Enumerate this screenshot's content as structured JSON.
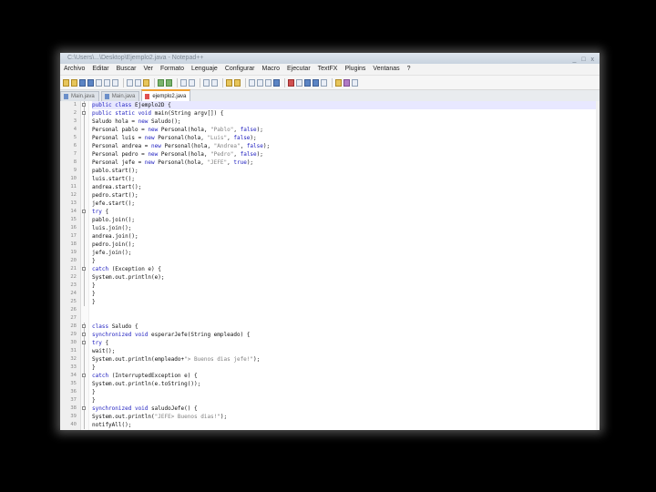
{
  "window": {
    "title": "C:\\Users\\...\\Desktop\\Ejemplo2.java - Notepad++",
    "controls": "_ □ x"
  },
  "menu": [
    "Archivo",
    "Editar",
    "Buscar",
    "Ver",
    "Formato",
    "Lenguaje",
    "Configurar",
    "Macro",
    "Ejecutar",
    "TextFX",
    "Plugins",
    "Ventanas",
    "?"
  ],
  "tabs": [
    {
      "label": "Main.java",
      "active": false
    },
    {
      "label": "Main.java",
      "active": false
    },
    {
      "label": "ejemplo2.java",
      "active": true
    }
  ],
  "lines": [
    {
      "n": "1",
      "fold": "box",
      "p": [
        [
          "kw",
          "public class "
        ],
        [
          "",
          "Ejemplo2D {"
        ]
      ]
    },
    {
      "n": "2",
      "fold": "box",
      "p": [
        [
          "kw",
          "public static void "
        ],
        [
          "",
          "main(String argv[]) {"
        ]
      ]
    },
    {
      "n": "3",
      "fold": "line",
      "p": [
        [
          "",
          "Saludo hola = "
        ],
        [
          "kw",
          "new "
        ],
        [
          "",
          "Saludo();"
        ]
      ]
    },
    {
      "n": "4",
      "fold": "line",
      "p": [
        [
          "",
          "Personal pablo = "
        ],
        [
          "kw",
          "new "
        ],
        [
          "",
          "Personal(hola, "
        ],
        [
          "str",
          "\"Pablo\""
        ],
        [
          "",
          ", "
        ],
        [
          "lit",
          "false"
        ],
        [
          "",
          ");"
        ]
      ]
    },
    {
      "n": "5",
      "fold": "line",
      "p": [
        [
          "",
          "Personal luis = "
        ],
        [
          "kw",
          "new "
        ],
        [
          "",
          "Personal(hola, "
        ],
        [
          "str",
          "\"Luis\""
        ],
        [
          "",
          ", "
        ],
        [
          "lit",
          "false"
        ],
        [
          "",
          ");"
        ]
      ]
    },
    {
      "n": "6",
      "fold": "line",
      "p": [
        [
          "",
          "Personal andrea = "
        ],
        [
          "kw",
          "new "
        ],
        [
          "",
          "Personal(hola, "
        ],
        [
          "str",
          "\"Andrea\""
        ],
        [
          "",
          ", "
        ],
        [
          "lit",
          "false"
        ],
        [
          "",
          ");"
        ]
      ]
    },
    {
      "n": "7",
      "fold": "line",
      "p": [
        [
          "",
          "Personal pedro = "
        ],
        [
          "kw",
          "new "
        ],
        [
          "",
          "Personal(hola, "
        ],
        [
          "str",
          "\"Pedro\""
        ],
        [
          "",
          ", "
        ],
        [
          "lit",
          "false"
        ],
        [
          "",
          ");"
        ]
      ]
    },
    {
      "n": "8",
      "fold": "line",
      "p": [
        [
          "",
          "Personal jefe = "
        ],
        [
          "kw",
          "new "
        ],
        [
          "",
          "Personal(hola, "
        ],
        [
          "str",
          "\"JEFE\""
        ],
        [
          "",
          ", "
        ],
        [
          "lit",
          "true"
        ],
        [
          "",
          ");"
        ]
      ]
    },
    {
      "n": "9",
      "fold": "line",
      "p": [
        [
          "",
          "pablo.start();"
        ]
      ]
    },
    {
      "n": "10",
      "fold": "line",
      "p": [
        [
          "",
          "luis.start();"
        ]
      ]
    },
    {
      "n": "11",
      "fold": "line",
      "p": [
        [
          "",
          "andrea.start();"
        ]
      ]
    },
    {
      "n": "12",
      "fold": "line",
      "p": [
        [
          "",
          "pedro.start();"
        ]
      ]
    },
    {
      "n": "13",
      "fold": "line",
      "p": [
        [
          "",
          "jefe.start();"
        ]
      ]
    },
    {
      "n": "14",
      "fold": "box",
      "p": [
        [
          "kw",
          "try "
        ],
        [
          "",
          "{"
        ]
      ]
    },
    {
      "n": "15",
      "fold": "line",
      "p": [
        [
          "",
          "pablo.join();"
        ]
      ]
    },
    {
      "n": "16",
      "fold": "line",
      "p": [
        [
          "",
          "luis.join();"
        ]
      ]
    },
    {
      "n": "17",
      "fold": "line",
      "p": [
        [
          "",
          "andrea.join();"
        ]
      ]
    },
    {
      "n": "18",
      "fold": "line",
      "p": [
        [
          "",
          "pedro.join();"
        ]
      ]
    },
    {
      "n": "19",
      "fold": "line",
      "p": [
        [
          "",
          "jefe.join();"
        ]
      ]
    },
    {
      "n": "20",
      "fold": "line",
      "p": [
        [
          "",
          "}"
        ]
      ]
    },
    {
      "n": "21",
      "fold": "box",
      "p": [
        [
          "kw",
          "catch "
        ],
        [
          "",
          "(Exception e) {"
        ]
      ]
    },
    {
      "n": "22",
      "fold": "line",
      "p": [
        [
          "",
          "System.out.println(e);"
        ]
      ]
    },
    {
      "n": "23",
      "fold": "line",
      "p": [
        [
          "",
          "}"
        ]
      ]
    },
    {
      "n": "24",
      "fold": "line",
      "p": [
        [
          "",
          "}"
        ]
      ]
    },
    {
      "n": "25",
      "fold": "line",
      "p": [
        [
          "",
          "}"
        ]
      ]
    },
    {
      "n": "26",
      "fold": "",
      "p": []
    },
    {
      "n": "27",
      "fold": "",
      "p": []
    },
    {
      "n": "28",
      "fold": "box",
      "p": [
        [
          "kw",
          "class "
        ],
        [
          "",
          "Saludo {"
        ]
      ]
    },
    {
      "n": "29",
      "fold": "box",
      "p": [
        [
          "kw",
          "synchronized void "
        ],
        [
          "",
          "esperarJefe(String empleado) {"
        ]
      ]
    },
    {
      "n": "30",
      "fold": "box",
      "p": [
        [
          "kw",
          "try "
        ],
        [
          "",
          "{"
        ]
      ]
    },
    {
      "n": "31",
      "fold": "line",
      "p": [
        [
          "",
          "wait();"
        ]
      ]
    },
    {
      "n": "32",
      "fold": "line",
      "p": [
        [
          "",
          "System.out.println(empleado+"
        ],
        [
          "str",
          "\"> Buenos dias jefe!\""
        ],
        [
          "",
          ");"
        ]
      ]
    },
    {
      "n": "33",
      "fold": "line",
      "p": [
        [
          "",
          "}"
        ]
      ]
    },
    {
      "n": "34",
      "fold": "box",
      "p": [
        [
          "kw",
          "catch "
        ],
        [
          "",
          "(InterruptedException e) {"
        ]
      ]
    },
    {
      "n": "35",
      "fold": "line",
      "p": [
        [
          "",
          "System.out.println(e.toString());"
        ]
      ]
    },
    {
      "n": "36",
      "fold": "line",
      "p": [
        [
          "",
          "}"
        ]
      ]
    },
    {
      "n": "37",
      "fold": "line",
      "p": [
        [
          "",
          "}"
        ]
      ]
    },
    {
      "n": "38",
      "fold": "box",
      "p": [
        [
          "kw",
          "synchronized void "
        ],
        [
          "",
          "saludoJefe() {"
        ]
      ]
    },
    {
      "n": "39",
      "fold": "line",
      "p": [
        [
          "",
          "System.out.println("
        ],
        [
          "str",
          "\"JEFE> Buenos dias!\""
        ],
        [
          "",
          ");"
        ]
      ]
    },
    {
      "n": "40",
      "fold": "line",
      "p": [
        [
          "",
          "notifyAll();"
        ]
      ]
    }
  ]
}
